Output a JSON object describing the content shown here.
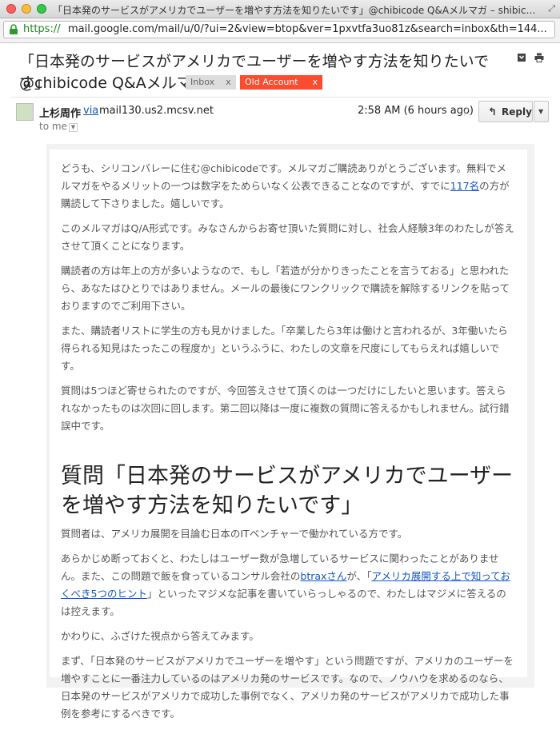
{
  "window": {
    "title": "「日本発のサービスがアメリカでユーザーを増やす方法を知りたいです」@chibicode Q&Aメルマガ – shibicode"
  },
  "url": {
    "scheme": "https://",
    "rest": "mail.google.com/mail/u/0/?ui=2&view=btop&ver=1pxvtfa3uo81z&search=inbox&th=144..."
  },
  "email": {
    "subject_line1": "「日本発のサービスがアメリカでユーザーを増やす方法を知りたいです」",
    "subject_line2": "@chibicode Q&Aメルマガ",
    "labels": [
      {
        "name": "Inbox",
        "close": "x",
        "color": "#dddddd"
      },
      {
        "name": "Old Account",
        "close": "x",
        "color": "#fb4c2f"
      }
    ],
    "sender": {
      "name": "上杉周作",
      "via": "via",
      "mailer": "mail130.us2.mcsv.net"
    },
    "to": "to me",
    "time": "2:58 AM (6 hours ago)",
    "reply_label": "Reply"
  },
  "body": {
    "p1_a": "どうも、シリコンバレーに住む@chibicodeです。メルマガご購読ありがとうございます。無料でメルマガをやるメリットの一つは数字をためらいなく公表できることなのですが、すでに",
    "p1_link": "117名",
    "p1_b": "の方が購読して下さりました。嬉しいです。",
    "p2": "このメルマガはQ/A形式です。みなさんからお寄せ頂いた質問に対し、社会人経験3年のわたしが答えさせて頂くことになります。",
    "p3": "購読者の方は年上の方が多いようなので、もし「若造が分かりきったことを言うておる」と思われたら、あなたはひとりではありません。メールの最後にワンクリックで購読を解除するリンクを貼っておりますのでご利用下さい。",
    "p4": "また、購読者リストに学生の方も見かけました。「卒業したら3年は働けと言われるが、3年働いたら得られる知見はたったこの程度か」というふうに、わたしの文章を尺度にしてもらえれば嬉しいです。",
    "p5": "質問は5つほど寄せられたのですが、今回答えさせて頂くのは一つだけにしたいと思います。答えられなかったものは次回に回します。第二回以降は一度に複数の質問に答えるかもしれません。試行錯誤中です。",
    "heading": "質問「日本発のサービスがアメリカでユーザーを増やす方法を知りたいです」",
    "p6": "質問者は、アメリカ展開を目論む日本のITベンチャーで働かれている方です。",
    "p7_a": "あらかじめ断っておくと、わたしはユーザー数が急増しているサービスに関わったことがありません。また、この問題で飯を食っているコンサル会社の",
    "p7_link1": "btraxさん",
    "p7_b": "が、「",
    "p7_link2": "アメリカ展開する上で知っておくべき5つのヒント",
    "p7_c": "」といったマジメな記事を書いていらっしゃるので、わたしはマジメに答えるのは控えます。",
    "p8": "かわりに、ふざけた視点から答えてみます。",
    "p9": "まず、「日本発のサービスがアメリカでユーザーを増やす」という問題ですが、アメリカのユーザーを増やすことに一番注力しているのはアメリカ発のサービスです。なので、ノウハウを求めるのなら、日本発のサービスがアメリカで成功した事例でなく、アメリカ発のサービスがアメリカで成功した事例を参考にするべきです。"
  }
}
